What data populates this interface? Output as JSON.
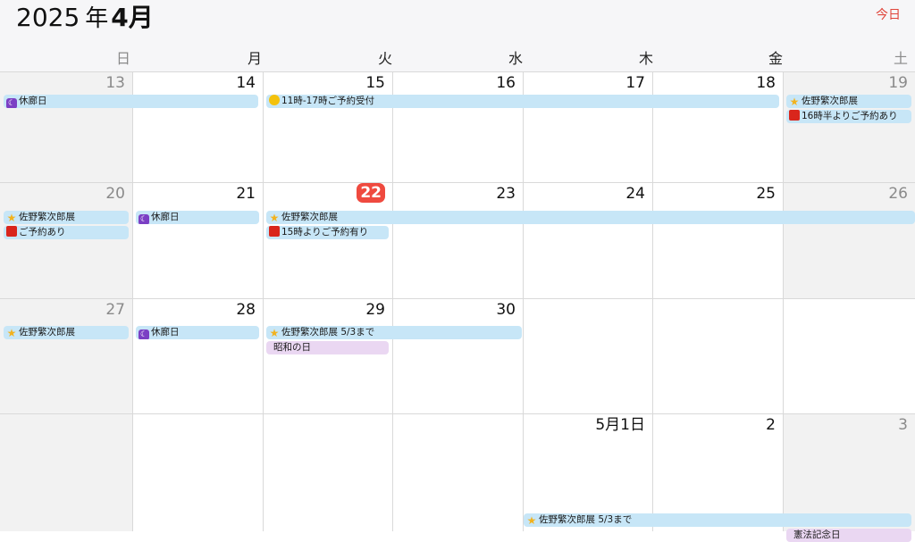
{
  "header": {
    "year": "2025",
    "year_suffix": "年",
    "month": "4月",
    "today_label": "今日"
  },
  "weekdays": [
    "日",
    "月",
    "火",
    "水",
    "木",
    "金",
    "土"
  ],
  "weeks": [
    {
      "days": [
        "13",
        "14",
        "15",
        "16",
        "17",
        "18",
        "19"
      ]
    },
    {
      "days": [
        "20",
        "21",
        "22",
        "23",
        "24",
        "25",
        "26"
      ]
    },
    {
      "days": [
        "27",
        "28",
        "29",
        "30",
        "",
        "",
        ""
      ]
    },
    {
      "days": [
        "",
        "",
        "",
        "",
        "5月1日",
        "2",
        "3"
      ]
    }
  ],
  "today": "22",
  "events": {
    "closed": "休廊日",
    "reservations_11_17": "11時-17時ご予約受付",
    "sano_exhibit": "佐野繁次郎展",
    "from_1630": "16時半よりご予約あり",
    "reserved": "ご予約あり",
    "from_15": "15時よりご予約有り",
    "sano_exhibit_until": "佐野繁次郎展 5/3まで",
    "showa_day": "昭和の日",
    "constitution_day": "憲法記念日"
  },
  "colors": {
    "event_bg": "#c7e6f7",
    "holiday_bg": "#ead7f2",
    "today_red": "#ef4a3f",
    "accent": "#e0443a"
  },
  "icons": [
    "moon-icon",
    "sun-icon",
    "star-icon",
    "red-square-icon"
  ]
}
